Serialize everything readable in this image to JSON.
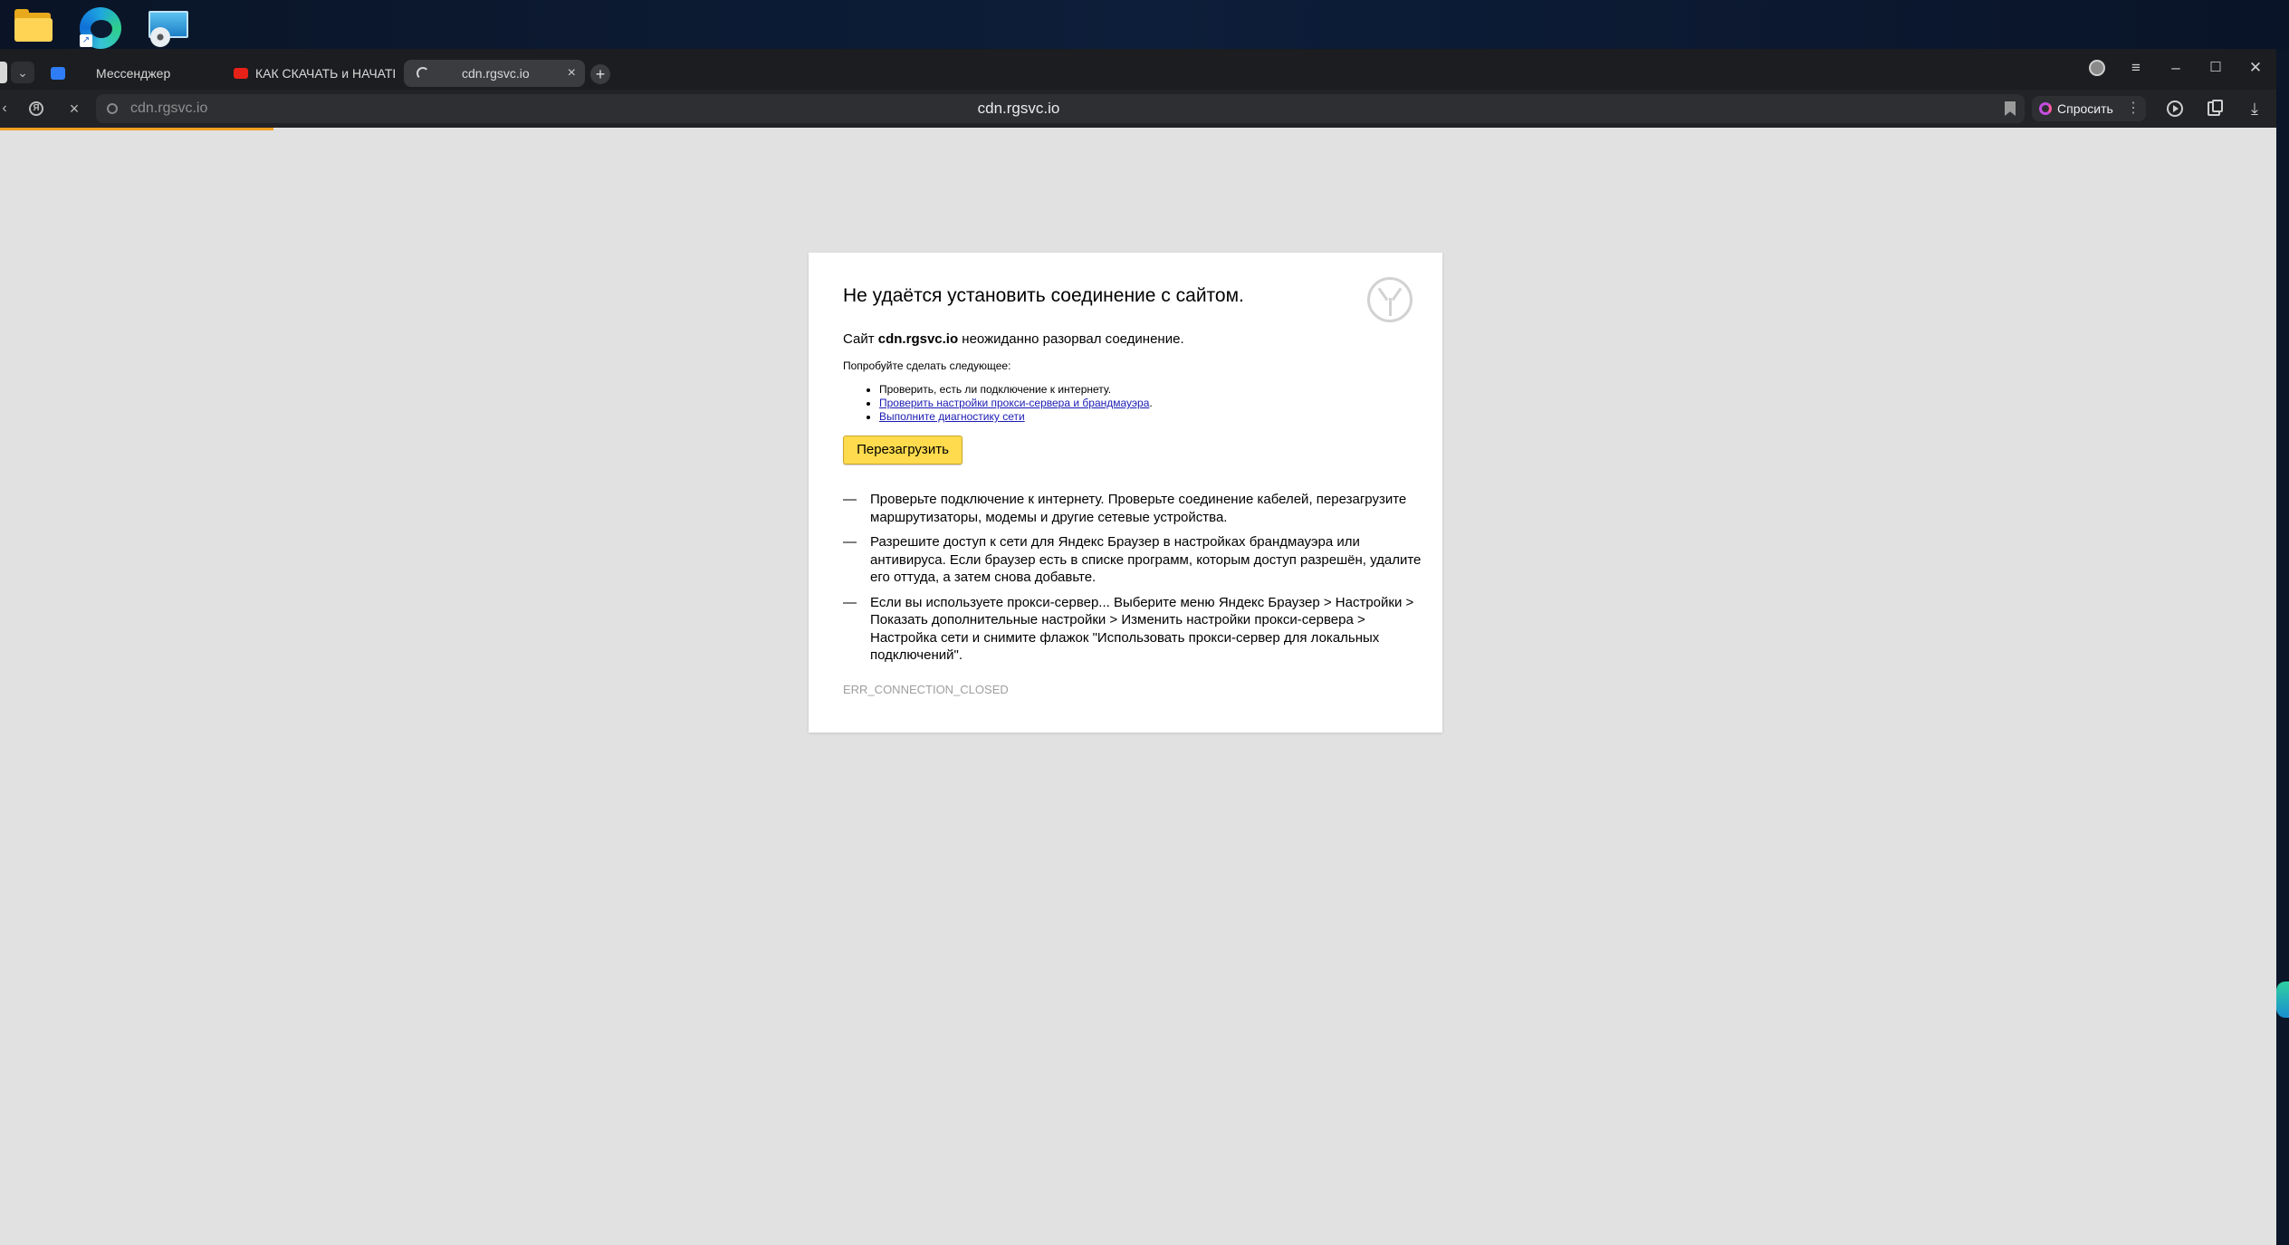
{
  "tabs": {
    "items": [
      {
        "label": "Мессенджер"
      },
      {
        "label": "КАК СКАЧАТЬ и НАЧАТЬ"
      },
      {
        "label": "cdn.rgsvc.io",
        "active": true
      }
    ],
    "close_glyph": "×",
    "new_tab_glyph": "+"
  },
  "address": {
    "host": "cdn.rgsvc.io",
    "center_title": "cdn.rgsvc.io",
    "ask_label": "Спросить"
  },
  "page_load_progress": 0.12,
  "error": {
    "title": "Не удаётся установить соединение с сайтом.",
    "site_prefix": "Сайт",
    "site": "cdn.rgsvc.io",
    "site_suffix": "неожиданно разорвал соединение.",
    "try_label": "Попробуйте сделать следующее:",
    "suggestions": [
      "Проверить, есть ли подключение к интернету.",
      "Проверить настройки прокси-сервера и брандмауэра",
      "Выполните диагностику сети"
    ],
    "suggestion_1_tail": ".",
    "reload_label": "Перезагрузить",
    "dash": "—",
    "hints": [
      "Проверьте подключение к интернету. Проверьте соединение кабелей, перезагрузите маршрутизаторы, модемы и другие сетевые устройства.",
      "Разрешите доступ к сети для Яндекс Браузер в настройках брандмауэра или антивируса. Если браузер есть в списке программ, которым доступ разрешён, удалите его оттуда, а затем снова добавьте.",
      "Если вы используете прокси-сервер... Выберите меню Яндекс Браузер > Настройки > Показать дополнительные настройки > Изменить настройки прокси-сервера > Настройка сети и снимите флажок \"Использовать прокси-сервер для локальных подключений\"."
    ],
    "code": "ERR_CONNECTION_CLOSED"
  },
  "colors": {
    "accent_button": "#ffdb4d",
    "progress": "#f0a020",
    "link": "#1b1bb4"
  },
  "icons": [
    "folder-icon",
    "edge-icon",
    "monitor-disc-icon",
    "messenger-icon",
    "youtube-icon",
    "loading-spinner-icon",
    "yandex-logo-icon",
    "lock-icon",
    "bookmark-icon",
    "download-icon"
  ]
}
